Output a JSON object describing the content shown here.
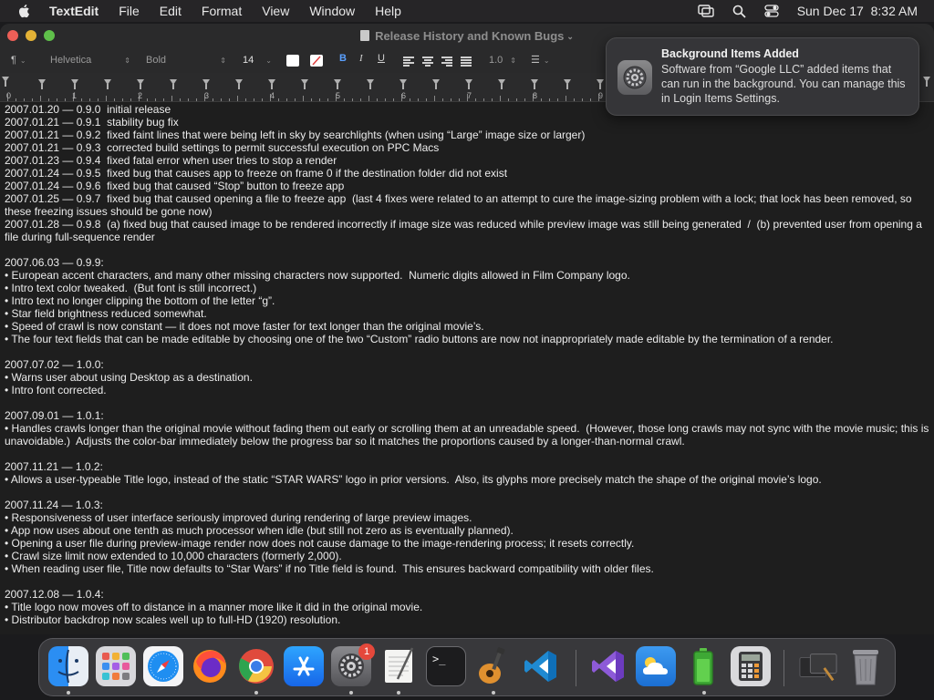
{
  "menubar": {
    "app_name": "TextEdit",
    "items": [
      "File",
      "Edit",
      "Format",
      "View",
      "Window",
      "Help"
    ],
    "clock": "Sun Dec 17  8:32 AM"
  },
  "window": {
    "title": "Release History and Known Bugs"
  },
  "toolbar": {
    "paragraph_style": "¶",
    "font_family": "Helvetica",
    "font_style": "Bold",
    "font_size": "14",
    "bold": "B",
    "italic": "I",
    "underline": "U",
    "line_spacing": "1.0"
  },
  "ruler": {
    "numbers": [
      "0",
      "1",
      "2",
      "3",
      "4",
      "5",
      "6",
      "7",
      "8",
      "9"
    ]
  },
  "notification": {
    "title": "Background Items Added",
    "body": "Software from “Google LLC” added items that can run in the background. You can manage this in Login Items Settings."
  },
  "document": {
    "lines": [
      "2007.01.20 — 0.9.0  initial release",
      "2007.01.21 — 0.9.1  stability bug fix",
      "2007.01.21 — 0.9.2  fixed faint lines that were being left in sky by searchlights (when using “Large” image size or larger)",
      "2007.01.21 — 0.9.3  corrected build settings to permit successful execution on PPC Macs",
      "2007.01.23 — 0.9.4  fixed fatal error when user tries to stop a render",
      "2007.01.24 — 0.9.5  fixed bug that causes app to freeze on frame 0 if the destination folder did not exist",
      "2007.01.24 — 0.9.6  fixed bug that caused “Stop” button to freeze app",
      "2007.01.25 — 0.9.7  fixed bug that caused opening a file to freeze app  (last 4 fixes were related to an attempt to cure the image-sizing problem with a lock; that lock has been removed, so these freezing issues should be gone now)",
      "2007.01.28 — 0.9.8  (a) fixed bug that caused image to be rendered incorrectly if image size was reduced while preview image was still being generated  /  (b) prevented user from opening a file during full-sequence render",
      "",
      "2007.06.03 — 0.9.9:",
      "• European accent characters, and many other missing characters now supported.  Numeric digits allowed in Film Company logo.",
      "• Intro text color tweaked.  (But font is still incorrect.)",
      "• Intro text no longer clipping the bottom of the letter “g”.",
      "• Star field brightness reduced somewhat.",
      "• Speed of crawl is now constant — it does not move faster for text longer than the original movie’s.",
      "• The four text fields that can be made editable by choosing one of the two “Custom” radio buttons are now not inappropriately made editable by the termination of a render.",
      "",
      "2007.07.02 — 1.0.0:",
      "• Warns user about using Desktop as a destination.",
      "• Intro font corrected.",
      "",
      "2007.09.01 — 1.0.1:",
      "• Handles crawls longer than the original movie without fading them out early or scrolling them at an unreadable speed.  (However, those long crawls may not sync with the movie music; this is unavoidable.)  Adjusts the color-bar immediately below the progress bar so it matches the proportions caused by a longer-than-normal crawl.",
      "",
      "2007.11.21 — 1.0.2:",
      "• Allows a user-typeable Title logo, instead of the static “STAR WARS” logo in prior versions.  Also, its glyphs more precisely match the shape of the original movie’s logo.",
      "",
      "2007.11.24 — 1.0.3:",
      "• Responsiveness of user interface seriously improved during rendering of large preview images.",
      "• App now uses about one tenth as much processor when idle (but still not zero as is eventually planned).",
      "• Opening a user file during preview-image render now does not cause damage to the image-rendering process; it resets correctly.",
      "• Crawl size limit now extended to 10,000 characters (formerly 2,000).",
      "• When reading user file, Title now defaults to “Star Wars” if no Title field is found.  This ensures backward compatibility with older files.",
      "",
      "2007.12.08 — 1.0.4:",
      "• Title logo now moves off to distance in a manner more like it did in the original movie.",
      "• Distributor backdrop now scales well up to full-HD (1920) resolution."
    ]
  },
  "dock": {
    "apps": [
      "Finder",
      "Launchpad",
      "Safari",
      "Firefox",
      "Chrome",
      "App Store",
      "System Settings",
      "TextEdit",
      "Terminal",
      "GarageBand",
      "Visual Studio Code",
      "Visual Studio",
      "Weather",
      "Battery",
      "Calculator",
      "Downloads",
      "Trash"
    ],
    "system_settings_badge": "1"
  }
}
